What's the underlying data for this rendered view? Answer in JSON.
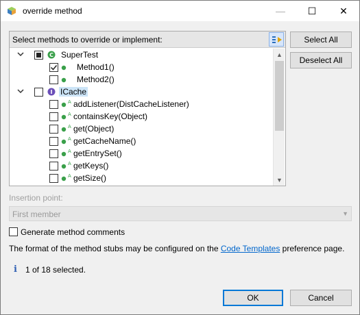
{
  "window": {
    "title": "override method",
    "minimize_glyph": "—",
    "maximize_glyph": "☐",
    "close_glyph": "✕"
  },
  "tree": {
    "header_label": "Select methods to override or implement:",
    "nodes": [
      {
        "label": "SuperTest",
        "kind": "class",
        "level": 0,
        "expanded": true,
        "check": "partial"
      },
      {
        "label": "Method1()",
        "kind": "method",
        "level": 1,
        "check": "checked",
        "abstract": false
      },
      {
        "label": "Method2()",
        "kind": "method",
        "level": 1,
        "check": "unchecked",
        "abstract": false
      },
      {
        "label": "ICache",
        "kind": "interface",
        "level": 0,
        "expanded": true,
        "check": "unchecked",
        "selected": true
      },
      {
        "label": "addListener(DistCacheListener)",
        "kind": "method",
        "level": 1,
        "check": "unchecked",
        "abstract": true
      },
      {
        "label": "containsKey(Object)",
        "kind": "method",
        "level": 1,
        "check": "unchecked",
        "abstract": true
      },
      {
        "label": "get(Object)",
        "kind": "method",
        "level": 1,
        "check": "unchecked",
        "abstract": true
      },
      {
        "label": "getCacheName()",
        "kind": "method",
        "level": 1,
        "check": "unchecked",
        "abstract": true
      },
      {
        "label": "getEntrySet()",
        "kind": "method",
        "level": 1,
        "check": "unchecked",
        "abstract": true
      },
      {
        "label": "getKeys()",
        "kind": "method",
        "level": 1,
        "check": "unchecked",
        "abstract": true
      },
      {
        "label": "getSize()",
        "kind": "method",
        "level": 1,
        "check": "unchecked",
        "abstract": true
      }
    ]
  },
  "buttons": {
    "select_all": "Select All",
    "deselect_all": "Deselect All",
    "ok": "OK",
    "cancel": "Cancel"
  },
  "insertion": {
    "label": "Insertion point:",
    "value": "First member"
  },
  "generate_comments": {
    "label": "Generate method comments",
    "checked": false
  },
  "info": {
    "prefix": "The format of the method stubs may be configured on the ",
    "link": "Code Templates",
    "suffix": " preference page."
  },
  "status": {
    "icon": "info-icon",
    "text": "1 of 18 selected."
  },
  "colors": {
    "selection": "#cce4f7",
    "link": "#0066cc",
    "default_button_border": "#0078d7",
    "method_dot": "#3aa04a",
    "class_icon": "#3aa04a",
    "interface_icon": "#6b4fb8"
  }
}
